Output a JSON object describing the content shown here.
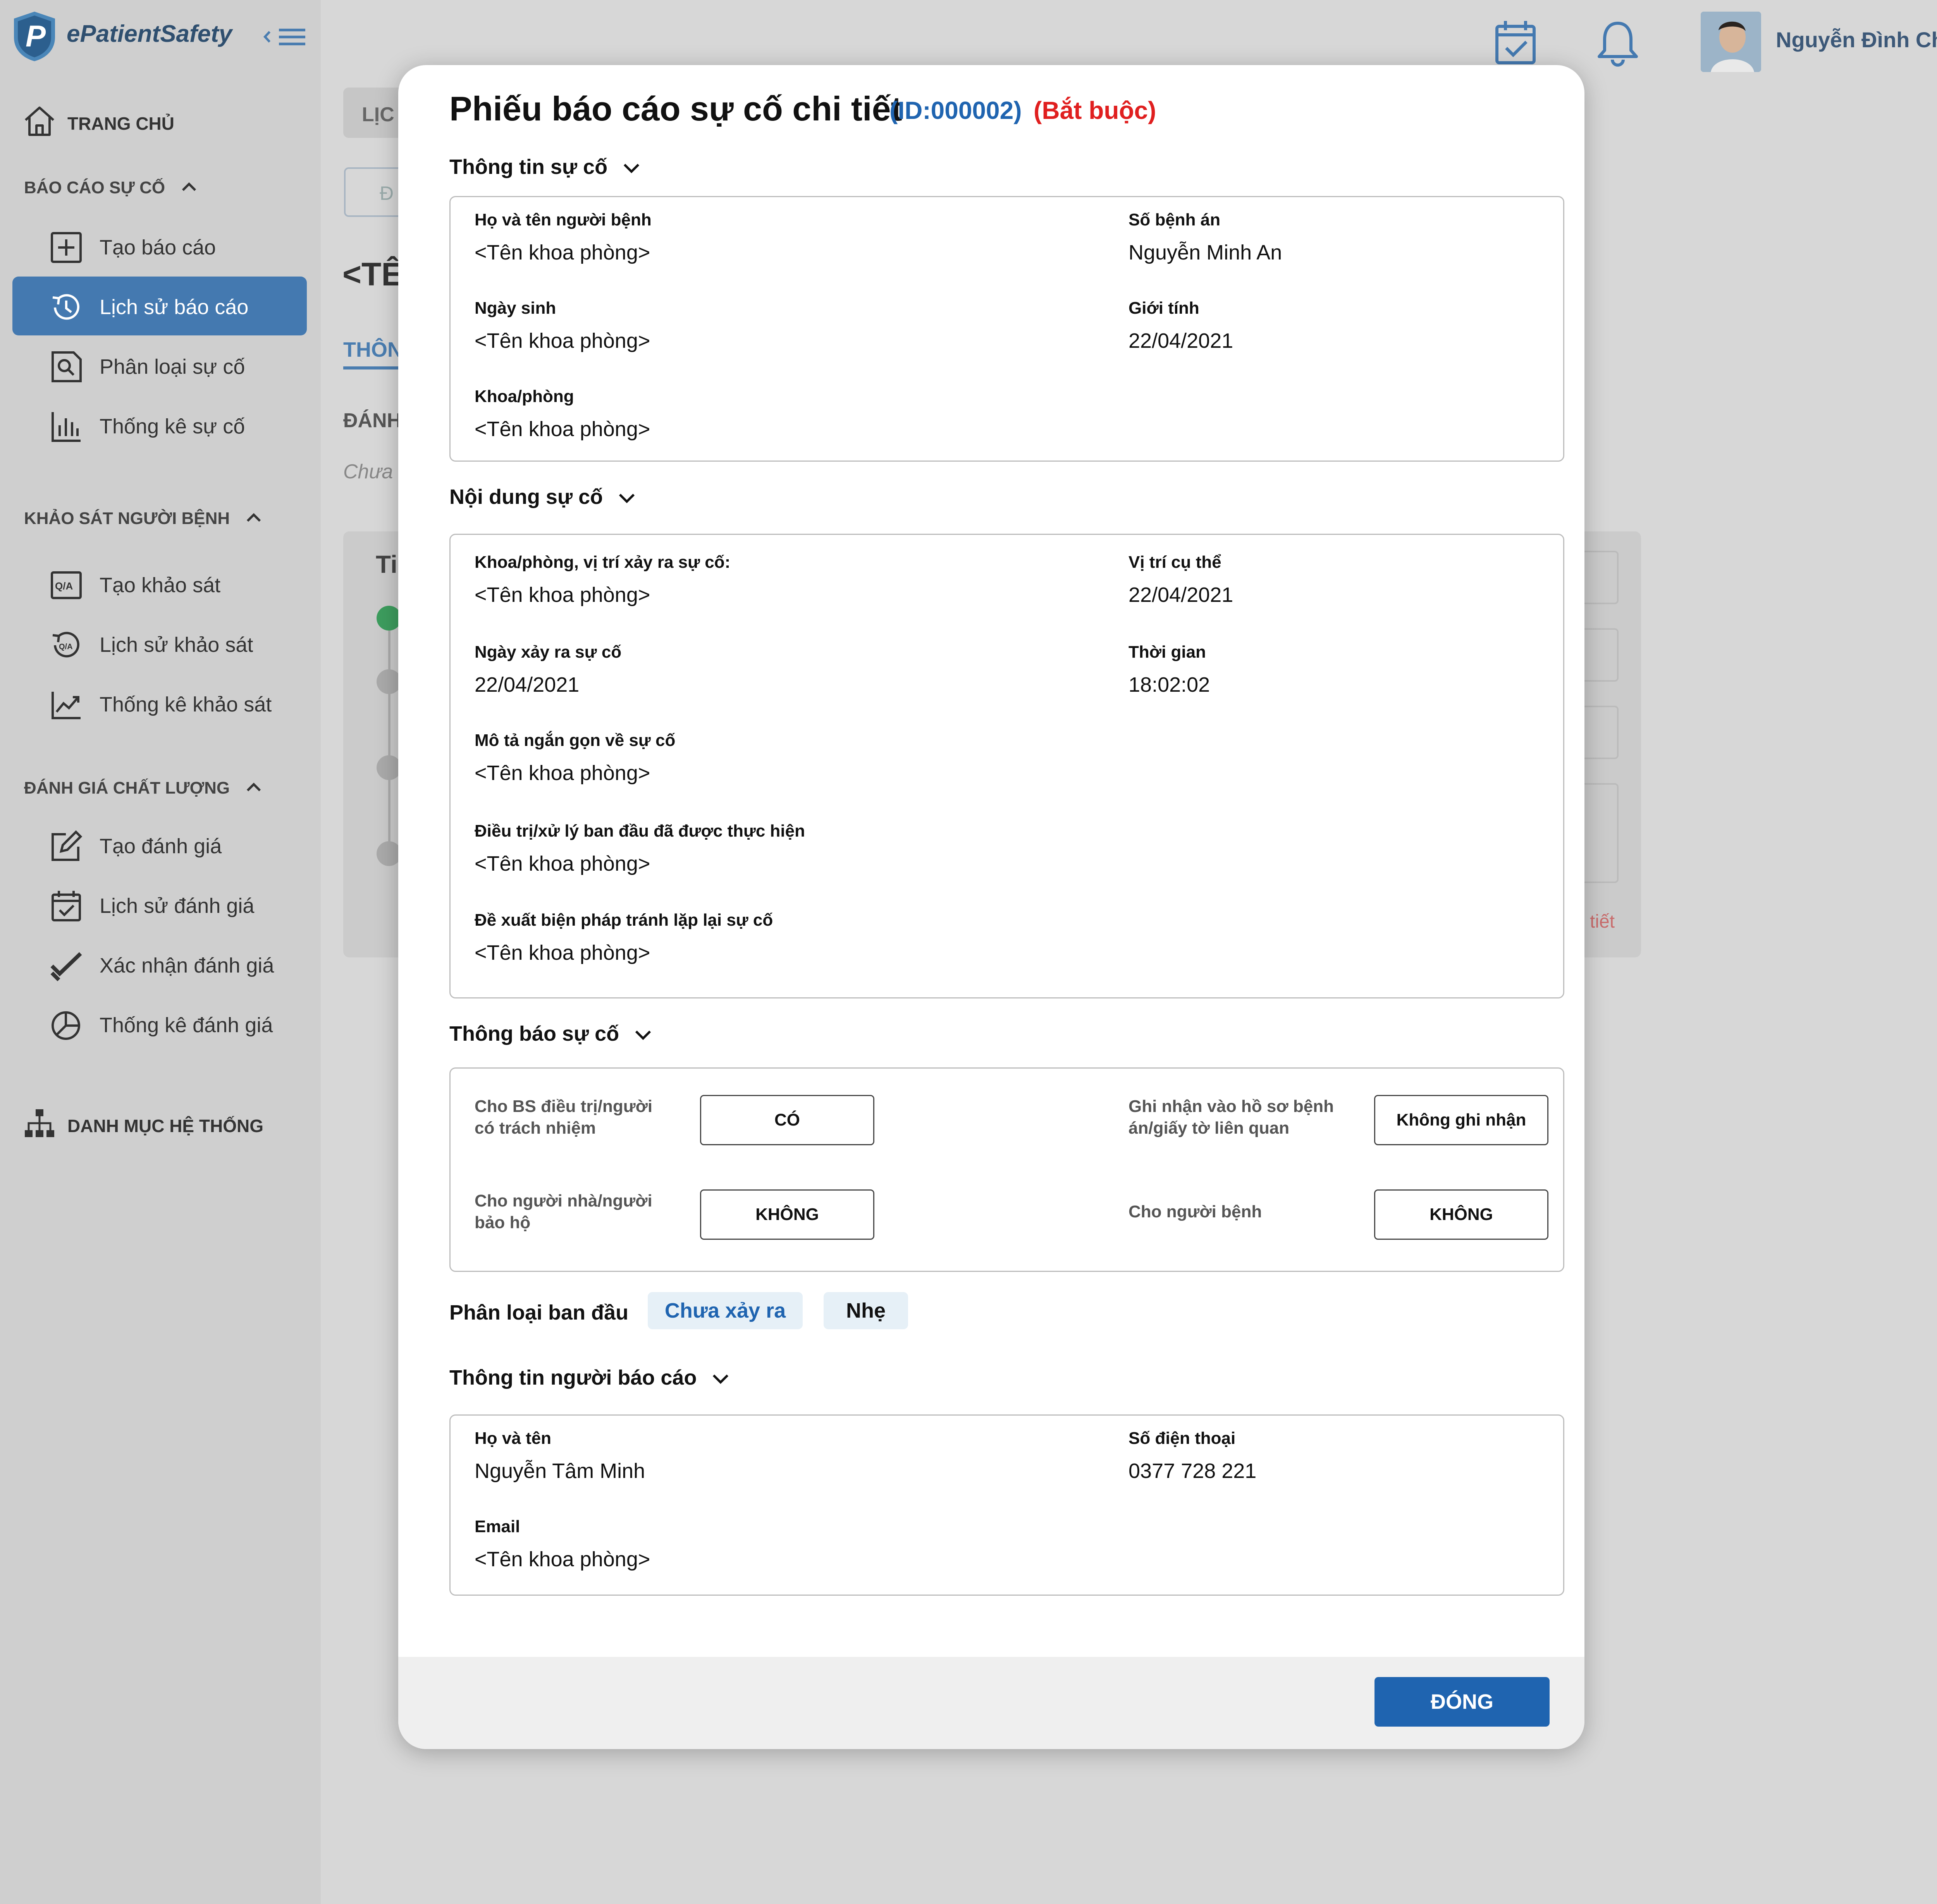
{
  "app": {
    "name": "ePatientSafety",
    "user_name": "Nguyễn Đình Chiện"
  },
  "sidebar": {
    "home": "TRANG CHỦ",
    "sections": [
      {
        "title": "BÁO CÁO SỰ CỐ",
        "items": [
          {
            "label": "Tạo báo cáo",
            "icon": "plus-square-icon"
          },
          {
            "label": "Lịch sử báo cáo",
            "icon": "history-icon",
            "active": true
          },
          {
            "label": "Phân loại sự cố",
            "icon": "classify-icon"
          },
          {
            "label": "Thống kê sự cố",
            "icon": "bar-chart-icon"
          }
        ]
      },
      {
        "title": "KHẢO SÁT NGƯỜI BỆNH",
        "items": [
          {
            "label": "Tạo khảo sát",
            "icon": "qa-icon"
          },
          {
            "label": "Lịch sử khảo sát",
            "icon": "qa-history-icon"
          },
          {
            "label": "Thống kê khảo sát",
            "icon": "trend-chart-icon"
          }
        ]
      },
      {
        "title": "ĐÁNH GIÁ CHẤT LƯỢNG",
        "items": [
          {
            "label": "Tạo đánh giá",
            "icon": "edit-icon"
          },
          {
            "label": "Lịch sử đánh giá",
            "icon": "calendar-check-icon"
          },
          {
            "label": "Xác nhận đánh giá",
            "icon": "double-check-icon"
          },
          {
            "label": "Thống kê đánh giá",
            "icon": "pie-chart-icon"
          }
        ]
      }
    ],
    "system": "DANH MỤC HỆ THỐNG"
  },
  "background": {
    "tab": "LỊC",
    "button": "Đ",
    "title": "<TÊ",
    "tab_thong": "THÔN",
    "danh": "ĐÁNH",
    "chua": "Chưa",
    "card_title": "Ti",
    "link_tiet": "tiết"
  },
  "modal": {
    "title": "Phiếu báo cáo sự cố chi tiết",
    "id": "(ID:000002)",
    "required": "(Bắt buộc)",
    "section1": {
      "title": "Thông tin sự cố",
      "fields": [
        {
          "label": "Họ và tên người bệnh",
          "value": "<Tên khoa phòng>"
        },
        {
          "label": "Số bệnh án",
          "value": "Nguyễn Minh An"
        },
        {
          "label": "Ngày sinh",
          "value": "<Tên khoa phòng>"
        },
        {
          "label": "Giới tính",
          "value": "22/04/2021"
        },
        {
          "label": "Khoa/phòng",
          "value": "<Tên khoa phòng>"
        }
      ]
    },
    "section2": {
      "title": "Nội dung sự cố",
      "fields": [
        {
          "label": "Khoa/phòng, vị trí xảy ra sự cố:",
          "value": "<Tên khoa phòng>"
        },
        {
          "label": "Vị trí cụ thể",
          "value": "22/04/2021"
        },
        {
          "label": "Ngày xảy ra sự cố",
          "value": "22/04/2021"
        },
        {
          "label": "Thời gian",
          "value": "18:02:02"
        },
        {
          "label": "Mô tả ngắn gọn về sự cố",
          "value": "<Tên khoa phòng>"
        },
        {
          "label": "Điều trị/xử lý ban đầu đã được thực hiện",
          "value": "<Tên khoa phòng>"
        },
        {
          "label": "Đề xuất biện pháp tránh lặp lại sự cố",
          "value": "<Tên khoa phòng>"
        }
      ]
    },
    "section3": {
      "title": "Thông báo sự cố",
      "items": [
        {
          "label": "Cho BS điều trị/người có trách nhiệm",
          "value": "CÓ"
        },
        {
          "label": "Ghi nhận vào hồ sơ bệnh án/giấy tờ liên quan",
          "value": "Không ghi nhận"
        },
        {
          "label": "Cho người nhà/người bảo hộ",
          "value": "KHÔNG"
        },
        {
          "label": "Cho người bệnh",
          "value": "KHÔNG"
        }
      ]
    },
    "classification": {
      "label": "Phân loại ban đầu",
      "chips": [
        "Chưa xảy ra",
        "Nhẹ"
      ],
      "chip_colors": [
        "#1f64b0",
        "#111111"
      ]
    },
    "section4": {
      "title": "Thông tin người báo cáo",
      "fields": [
        {
          "label": "Họ và tên",
          "value": "Nguyễn Tâm Minh"
        },
        {
          "label": "Số điện thoại",
          "value": "0377 728 221"
        },
        {
          "label": "Email",
          "value": "<Tên khoa phòng>"
        }
      ]
    },
    "close_button": "ĐÓNG"
  },
  "colors": {
    "accent": "#1f64b0",
    "required": "#e01f1f",
    "sidebar_active": "#4479b0"
  }
}
